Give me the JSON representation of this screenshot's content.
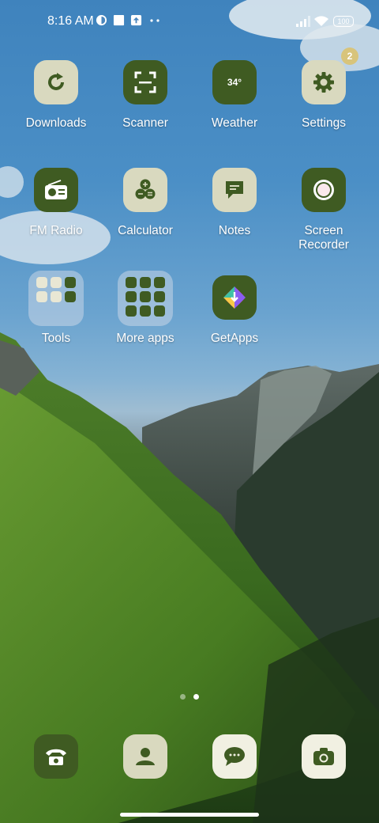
{
  "status": {
    "time": "8:16 AM",
    "battery": "100"
  },
  "apps": [
    {
      "label": "Downloads",
      "icon": "refresh-icon"
    },
    {
      "label": "Scanner",
      "icon": "scan-icon"
    },
    {
      "label": "Weather",
      "icon": "weather-icon",
      "temp": "34°"
    },
    {
      "label": "Settings",
      "icon": "gear-icon",
      "badge": "2"
    },
    {
      "label": "FM Radio",
      "icon": "radio-icon"
    },
    {
      "label": "Calculator",
      "icon": "calculator-icon"
    },
    {
      "label": "Notes",
      "icon": "note-icon"
    },
    {
      "label": "Screen Recorder",
      "icon": "record-icon"
    },
    {
      "label": "Tools",
      "icon": "folder-icon"
    },
    {
      "label": "More apps",
      "icon": "folder-icon"
    },
    {
      "label": "GetApps",
      "icon": "getapps-icon"
    }
  ],
  "pager": {
    "pages": 2,
    "active": 1
  },
  "dock": [
    {
      "icon": "phone-icon"
    },
    {
      "icon": "contacts-icon"
    },
    {
      "icon": "messages-icon"
    },
    {
      "icon": "camera-icon"
    }
  ],
  "colors": {
    "tile_light": "#d9d9bf",
    "tile_dark": "#3f5b22",
    "badge": "#d8c47b"
  }
}
